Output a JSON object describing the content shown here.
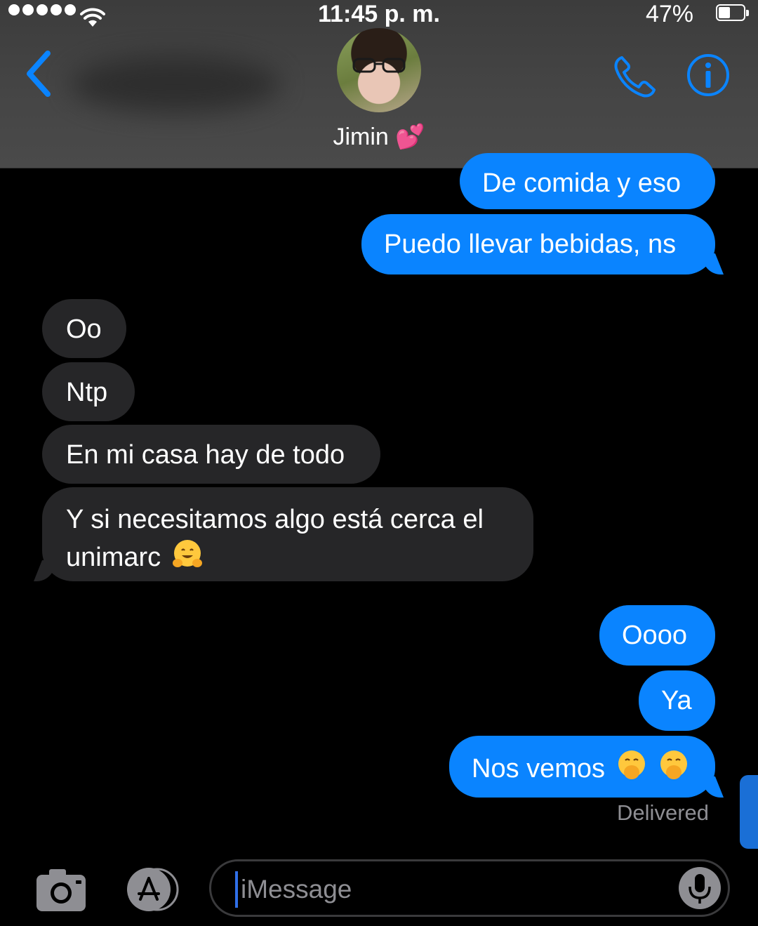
{
  "status_bar": {
    "time": "11:45 p. m.",
    "battery_percent": "47%",
    "battery_level": 0.47
  },
  "header": {
    "contact_name": "Jimin 💕"
  },
  "messages": [
    {
      "side": "sent",
      "text": "De comida y eso"
    },
    {
      "side": "sent",
      "text": "Puedo llevar bebidas, ns"
    },
    {
      "side": "received",
      "text": "Oo"
    },
    {
      "side": "received",
      "text": "Ntp"
    },
    {
      "side": "received",
      "text": "En mi casa hay de todo"
    },
    {
      "side": "received",
      "text_line1": "Y si necesitamos algo está cerca el",
      "text_line2": "unimarc",
      "emoji": "hugging-face"
    },
    {
      "side": "sent",
      "text": "Oooo"
    },
    {
      "side": "sent",
      "text": "Ya"
    },
    {
      "side": "sent",
      "text": "Nos vemos",
      "emoji": "face-with-hand-over-mouth ×2"
    }
  ],
  "delivery_status": "Delivered",
  "input": {
    "placeholder": "iMessage"
  },
  "colors": {
    "sent_bubble": "#0a84ff",
    "received_bubble": "#262628",
    "accent": "#0a84ff",
    "background": "#000000"
  }
}
